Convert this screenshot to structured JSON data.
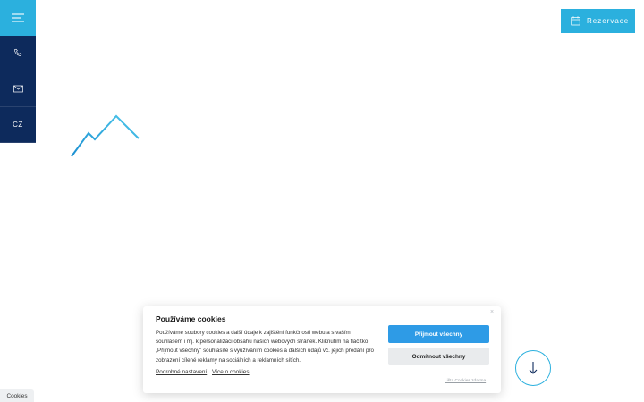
{
  "colors": {
    "accent": "#2bb0de",
    "nav_dark": "#0d2a5c",
    "accept": "#2e9be6"
  },
  "side_nav": [
    {
      "icon": "menu-icon",
      "label": ""
    },
    {
      "icon": "phone-icon",
      "label": ""
    },
    {
      "icon": "mail-icon",
      "label": ""
    },
    {
      "icon": "",
      "label": "CZ"
    }
  ],
  "header": {
    "reserve_label": "Rezervace",
    "reserve_icon": "calendar-icon"
  },
  "logo": {
    "icon": "mountain-logo"
  },
  "scroll": {
    "icon": "arrow-down-icon"
  },
  "cookie_banner": {
    "close": "×",
    "title": "Používáme cookies",
    "text": "Používáme soubory cookies a další údaje k zajištění funkčnosti webu a s vaším souhlasem i mj. k personalizaci obsahu našich webových stránek. Kliknutím na tlačítko „Přijmout všechny\" souhlasíte s využíváním cookies a dalších údajů vč. jejich předání pro zobrazení cílené reklamy na sociálních a reklamních sítích.",
    "link_settings": "Podrobné nastavení",
    "link_more": "Více o cookies",
    "accept_label": "Přijmout všechny",
    "reject_label": "Odmítnout všechny",
    "brand": "Lišta Cookies zdarma"
  },
  "cookie_tab": {
    "label": "Cookies"
  }
}
